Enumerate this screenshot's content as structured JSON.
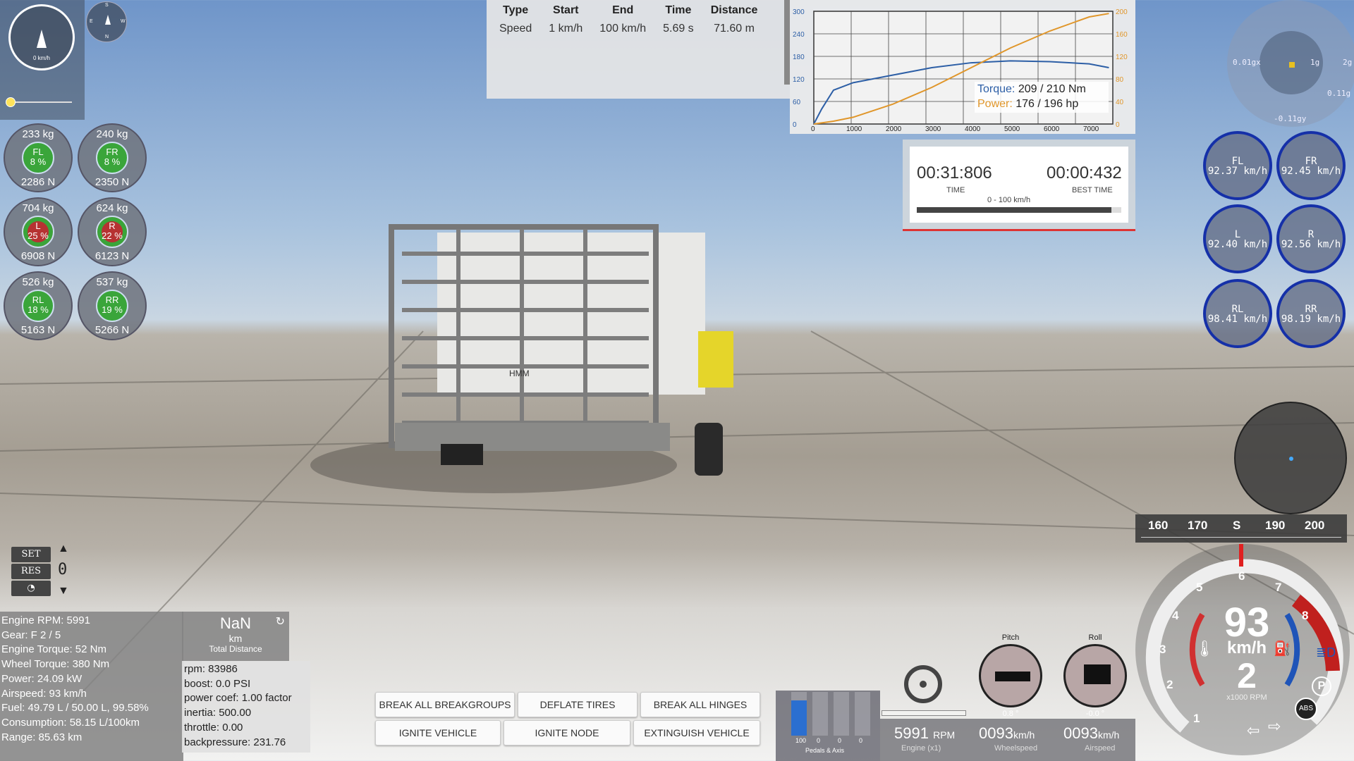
{
  "mini_speed": {
    "label": "0 km/h"
  },
  "compass_small": {
    "n": "N",
    "s": "S",
    "e": "E",
    "w": "W"
  },
  "tires": [
    {
      "id": "FL",
      "kg": "233  kg",
      "pct": "8 %",
      "n": "2286  N",
      "red": false
    },
    {
      "id": "FR",
      "kg": "240  kg",
      "pct": "8 %",
      "n": "2350  N",
      "red": false
    },
    {
      "id": "L",
      "kg": "704  kg",
      "pct": "25 %",
      "n": "6908  N",
      "red": true
    },
    {
      "id": "R",
      "kg": "624  kg",
      "pct": "22 %",
      "n": "6123  N",
      "red": true
    },
    {
      "id": "RL",
      "kg": "526  kg",
      "pct": "18 %",
      "n": "5163  N",
      "red": false
    },
    {
      "id": "RR",
      "kg": "537  kg",
      "pct": "19 %",
      "n": "5266  N",
      "red": false
    }
  ],
  "drag": {
    "headers": [
      "Type",
      "Start",
      "End",
      "Time",
      "Distance"
    ],
    "row": [
      "Speed",
      "1 km/h",
      "100 km/h",
      "5.69 s",
      "71.60 m"
    ]
  },
  "torque_graph": {
    "left_ticks": [
      "300",
      "240",
      "180",
      "120",
      "60",
      "0"
    ],
    "right_ticks": [
      "200",
      "160",
      "120",
      "80",
      "40",
      "0"
    ],
    "x_ticks": [
      "0",
      "1000",
      "2000",
      "3000",
      "4000",
      "5000",
      "6000",
      "7000"
    ],
    "torque_label": "Torque:",
    "torque_value": "209 / 210 Nm",
    "power_label": "Power:",
    "power_value": "176 / 196 hp",
    "colors": {
      "torque": "#2d5fa6",
      "power": "#e0962a"
    }
  },
  "timer": {
    "time": "00:31:806",
    "time_label": "TIME",
    "best": "00:00:432",
    "best_label": "BEST TIME",
    "subtitle": "0 - 100 km/h",
    "progress": 0.95
  },
  "gforce": {
    "l": "0.01gx",
    "c1": "1g",
    "c2": "2g",
    "r": "0.11g",
    "b": "-0.11gy"
  },
  "wheel_speeds": [
    {
      "id": "FL",
      "v": "92.37 km/h"
    },
    {
      "id": "FR",
      "v": "92.45 km/h"
    },
    {
      "id": "L",
      "v": "92.40 km/h"
    },
    {
      "id": "R",
      "v": "92.56 km/h"
    },
    {
      "id": "RL",
      "v": "98.41 km/h"
    },
    {
      "id": "RR",
      "v": "98.19 km/h"
    }
  ],
  "compass_tape": {
    "ticks": [
      "160",
      "170",
      "S",
      "190",
      "200"
    ]
  },
  "cruise": {
    "set": "SET",
    "res": "RES",
    "value": "0"
  },
  "engine": {
    "lines": [
      "Engine RPM: 5991",
      "Gear: F 2 / 5",
      "Engine Torque: 52 Nm",
      "Wheel Torque: 380 Nm",
      "Power: 24.09 kW",
      "Airspeed: 93 km/h",
      "Fuel: 49.79 L / 50.00 L, 99.58%",
      "Consumption: 58.15 L/100km",
      "Range: 85.63 km"
    ]
  },
  "odometer": {
    "value": "NaN",
    "unit": "km",
    "label": "Total Distance"
  },
  "turbo": {
    "lines": [
      "rpm: 83986",
      "boost: 0.0 PSI",
      "power coef: 1.00 factor",
      "inertia: 500.00",
      "throttle: 0.00",
      "backpressure: 231.76"
    ]
  },
  "buttons": {
    "break_groups": "BREAK ALL BREAKGROUPS",
    "deflate": "DEFLATE TIRES",
    "break_hinges": "BREAK ALL HINGES",
    "ignite_vehicle": "IGNITE VEHICLE",
    "ignite_node": "IGNITE NODE",
    "extinguish": "EXTINGUISH VEHICLE"
  },
  "pedals": {
    "values": [
      "100",
      "0",
      "0",
      "0"
    ],
    "fills": [
      0.8,
      0,
      0,
      0
    ],
    "label": "Pedals & Axis"
  },
  "digital": {
    "rpm": "5991",
    "rpm_unit": "RPM",
    "rpm_cap": "Engine (x1)",
    "ws": "0093",
    "ws_unit": "km/h",
    "ws_cap": "Wheelspeed",
    "as": "0093",
    "as_unit": "km/h",
    "as_cap": "Airspeed"
  },
  "attitude": {
    "pitch": "Pitch",
    "pitch_val": "0.8 °",
    "roll": "Roll",
    "roll_val": "-0.0 °"
  },
  "tacho": {
    "speed": "93",
    "unit": "km/h",
    "gear": "2",
    "rpm_label": "x1000 RPM",
    "numbers": [
      "1",
      "2",
      "3",
      "4",
      "5",
      "6",
      "7",
      "8"
    ],
    "park": "P",
    "abs": "ABS"
  },
  "license_plate": "HMM"
}
